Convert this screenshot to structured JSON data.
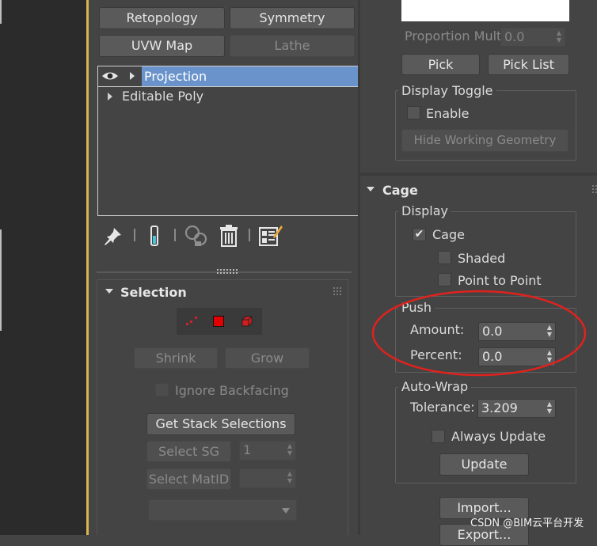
{
  "modifier_buttons": {
    "retopology": "Retopology",
    "symmetry": "Symmetry",
    "uvw_map": "UVW Map",
    "lathe": "Lathe"
  },
  "stack": {
    "items": [
      {
        "label": "Projection",
        "selected": true
      },
      {
        "label": "Editable Poly",
        "selected": false
      }
    ]
  },
  "selection": {
    "title": "Selection",
    "shrink": "Shrink",
    "grow": "Grow",
    "ignore_backfacing": "Ignore Backfacing",
    "get_stack_selections": "Get Stack Selections",
    "select_sg": "Select SG",
    "sg_value": "1",
    "select_matid": "Select MatID"
  },
  "right": {
    "proportion_mult_label": "Proportion Mult:",
    "proportion_mult_value": "0.0",
    "pick": "Pick",
    "pick_list": "Pick List",
    "display_toggle": {
      "title": "Display Toggle",
      "enable": "Enable",
      "hide_working_geometry": "Hide Working Geometry"
    },
    "cage": {
      "title": "Cage",
      "display": {
        "title": "Display",
        "cage_label": "Cage",
        "cage_checked": true,
        "shaded": "Shaded",
        "point_to_point": "Point to Point"
      },
      "push": {
        "title": "Push",
        "amount_label": "Amount:",
        "amount_value": "0.0",
        "percent_label": "Percent:",
        "percent_value": "0.0"
      },
      "auto_wrap": {
        "title": "Auto-Wrap",
        "tolerance_label": "Tolerance:",
        "tolerance_value": "3.209",
        "always_update": "Always Update",
        "update": "Update"
      },
      "import": "Import...",
      "export": "Export..."
    }
  },
  "watermark": "CSDN @BIM云平台开发",
  "colors": {
    "selection_highlight": "#6a93cb",
    "annotation_circle": "#e0221e",
    "viewport": "#2b2b2b"
  }
}
